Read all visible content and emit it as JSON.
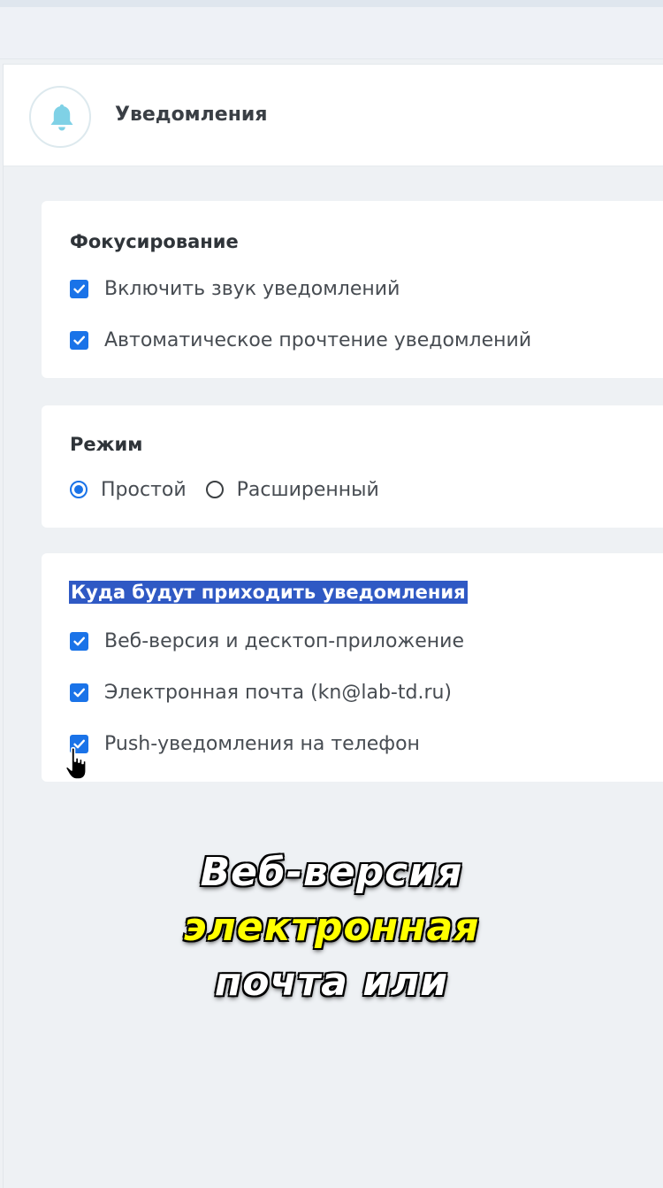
{
  "header": {
    "title": "Уведомления",
    "icon": "bell-icon"
  },
  "focus_section": {
    "title": "Фокусирование",
    "options": [
      {
        "label": "Включить звук уведомлений",
        "checked": true
      },
      {
        "label": "Автоматическое прочтение уведомлений",
        "checked": true
      }
    ]
  },
  "mode_section": {
    "title": "Режим",
    "options": [
      {
        "label": "Простой",
        "selected": true
      },
      {
        "label": "Расширенный",
        "selected": false
      }
    ]
  },
  "delivery_section": {
    "title": "Куда будут приходить уведомления",
    "options": [
      {
        "label": "Веб-версия и десктоп-приложение",
        "checked": true
      },
      {
        "label": "Электронная почта (kn@lab-td.ru)",
        "checked": true
      },
      {
        "label": "Push-уведомления на телефон",
        "checked": true
      }
    ]
  },
  "caption": {
    "line1": "Веб-версия",
    "line2": "электронная",
    "line3": "почта или"
  },
  "colors": {
    "accent": "#1a73e8",
    "selection_highlight": "#2f59c4",
    "bell": "#7fd1e6",
    "caption_highlight": "#ffff00"
  }
}
